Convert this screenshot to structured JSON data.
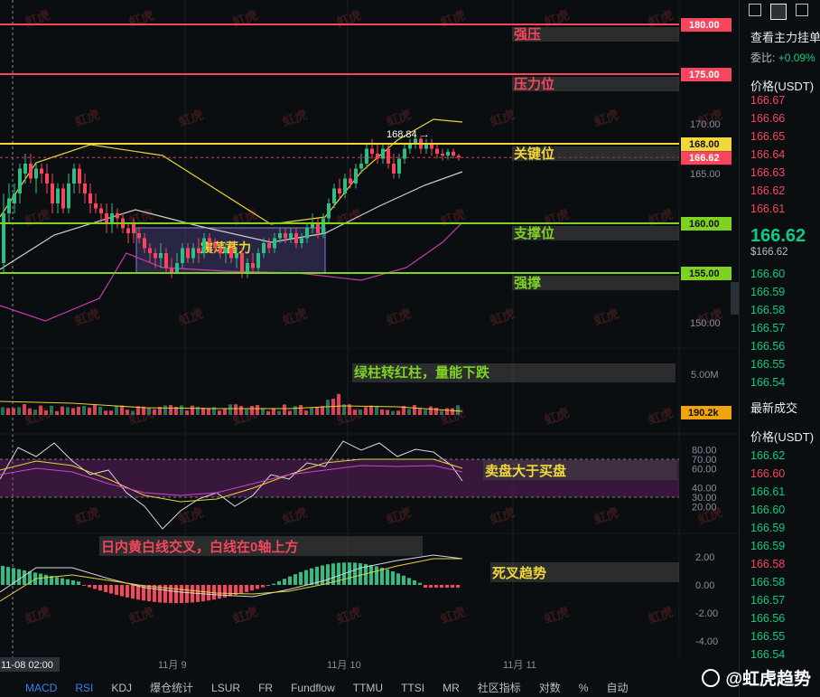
{
  "chart_data": {
    "type": "candlestick",
    "symbol_price": "166.62",
    "y_ticks": [
      "170.00",
      "165.00",
      "150.00"
    ],
    "y_range": [
      147.0,
      182.0
    ],
    "x_labels": [
      "11-08 02:00",
      "11月 9",
      "11月 10",
      "11月 11"
    ],
    "price_max_label": "168.84 →",
    "levels": [
      {
        "value": 180.0,
        "tag": "180.00",
        "label": "强压",
        "color": "#f6465d"
      },
      {
        "value": 175.0,
        "tag": "175.00",
        "label": "压力位",
        "color": "#f6465d"
      },
      {
        "value": 168.0,
        "tag": "168.00",
        "label": "关键位",
        "color": "#f0d83a"
      },
      {
        "value": 160.0,
        "tag": "160.00",
        "label": "支撑位",
        "color": "#7ed321"
      },
      {
        "value": 155.0,
        "tag": "155.00",
        "label": "强撑",
        "color": "#7ed321"
      }
    ],
    "current_price_tag": "166.62",
    "consolidation_label": "震荡蓄力",
    "volume": {
      "ticks": [
        "5.00M"
      ],
      "tag": "190.2k",
      "note": "绿柱转红柱，量能下跌"
    },
    "rsi": {
      "ticks": [
        "80.00",
        "70.00",
        "60.00",
        "40.00",
        "30.00",
        "20.00"
      ],
      "note": "卖盘大于买盘"
    },
    "macd": {
      "ticks": [
        "2.00",
        "0.00",
        "-2.00",
        "-4.00"
      ],
      "note_top": "日内黄白线交叉，白线在0轴上方",
      "note_bottom": "死叉趋势"
    }
  },
  "bottom_tabs": [
    "MACD",
    "RSI",
    "KDJ",
    "爆仓统计",
    "LSUR",
    "FR",
    "Fundflow",
    "TTMU",
    "TTSI",
    "MR",
    "社区指标",
    "对数",
    "%",
    "自动"
  ],
  "watermark_text": "虹虎",
  "brand": "@虹虎趋势",
  "right_panel": {
    "title": "查看主力挂单",
    "ratio_label": "委比:",
    "ratio_value": "+0.09%",
    "price_header": "价格(USDT)",
    "asks": [
      "166.67",
      "166.66",
      "166.65",
      "166.64",
      "166.63",
      "166.62",
      "166.61"
    ],
    "last_price": "166.62",
    "last_price_sub": "$166.62",
    "bids": [
      "166.60",
      "166.59",
      "166.58",
      "166.57",
      "166.56",
      "166.55",
      "166.54"
    ],
    "trades_title": "最新成交",
    "trades_header": "价格(USDT)",
    "trades": [
      {
        "p": "166.62",
        "c": "g"
      },
      {
        "p": "166.60",
        "c": "r"
      },
      {
        "p": "166.61",
        "c": "g"
      },
      {
        "p": "166.60",
        "c": "g"
      },
      {
        "p": "166.59",
        "c": "g"
      },
      {
        "p": "166.59",
        "c": "g"
      },
      {
        "p": "166.58",
        "c": "r"
      },
      {
        "p": "166.58",
        "c": "g"
      },
      {
        "p": "166.57",
        "c": "g"
      },
      {
        "p": "166.56",
        "c": "g"
      },
      {
        "p": "166.55",
        "c": "g"
      },
      {
        "p": "166.54",
        "c": "g"
      }
    ]
  }
}
